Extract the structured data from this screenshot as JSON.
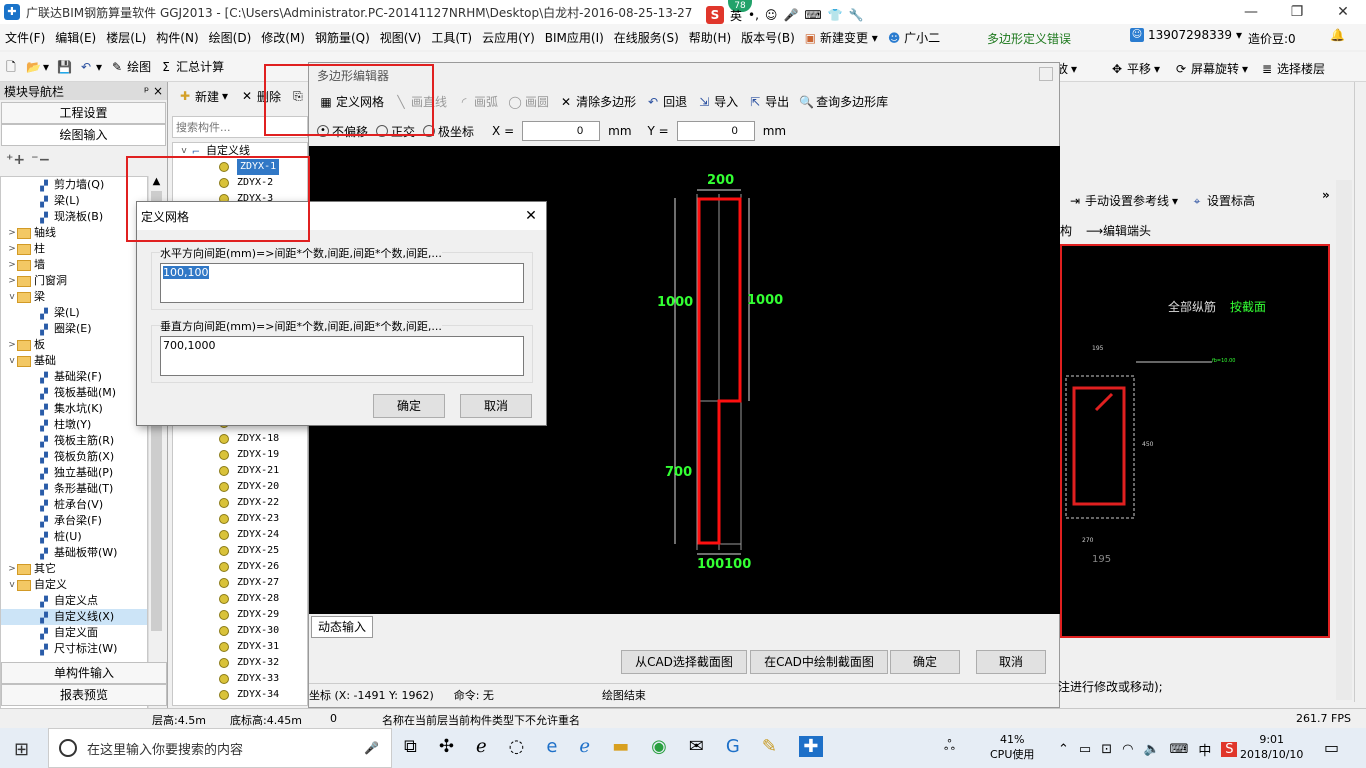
{
  "window": {
    "title": "广联达BIM钢筋算量软件 GGJ2013 - [C:\\Users\\Administrator.PC-20141127NRHM\\Desktop\\白龙村-2016-08-25-13-27",
    "badge": "78",
    "ime_label": "英"
  },
  "menu": {
    "items": [
      "文件(F)",
      "编辑(E)",
      "楼层(L)",
      "构件(N)",
      "绘图(D)",
      "修改(M)",
      "钢筋量(Q)",
      "视图(V)",
      "工具(T)",
      "云应用(Y)",
      "BIM应用(I)",
      "在线服务(S)",
      "帮助(H)",
      "版本号(B)",
      "新建变更",
      "广小二"
    ],
    "error_text": "多边形定义错误",
    "phone": "13907298339",
    "cost_bean": "造价豆:0"
  },
  "toolbar": {
    "draw": "绘图",
    "sum_calc": "汇总计算",
    "zoom": "缩放",
    "pan": "平移",
    "rotate": "屏幕旋转",
    "select_floor": "选择楼层"
  },
  "nav": {
    "title": "模块导航栏",
    "pin": "ᵖ ×",
    "project_settings": "工程设置",
    "drawing_input": "绘图输入",
    "single_input": "单构件输入",
    "report_preview": "报表预览",
    "tree": [
      {
        "label": "剪力墙(Q)",
        "level": 2,
        "kind": "comp"
      },
      {
        "label": "梁(L)",
        "level": 2,
        "kind": "comp"
      },
      {
        "label": "现浇板(B)",
        "level": 2,
        "kind": "comp"
      },
      {
        "label": "轴线",
        "level": 1,
        "kind": "folder",
        "toggle": ">"
      },
      {
        "label": "柱",
        "level": 1,
        "kind": "folder",
        "toggle": ">"
      },
      {
        "label": "墙",
        "level": 1,
        "kind": "folder",
        "toggle": ">"
      },
      {
        "label": "门窗洞",
        "level": 1,
        "kind": "folder",
        "toggle": ">"
      },
      {
        "label": "梁",
        "level": 1,
        "kind": "folder",
        "toggle": "v"
      },
      {
        "label": "梁(L)",
        "level": 2,
        "kind": "comp"
      },
      {
        "label": "圈梁(E)",
        "level": 2,
        "kind": "comp"
      },
      {
        "label": "板",
        "level": 1,
        "kind": "folder",
        "toggle": ">"
      },
      {
        "label": "基础",
        "level": 1,
        "kind": "folder",
        "toggle": "v"
      },
      {
        "label": "基础梁(F)",
        "level": 2,
        "kind": "comp"
      },
      {
        "label": "筏板基础(M)",
        "level": 2,
        "kind": "comp"
      },
      {
        "label": "集水坑(K)",
        "level": 2,
        "kind": "comp"
      },
      {
        "label": "柱墩(Y)",
        "level": 2,
        "kind": "comp"
      },
      {
        "label": "筏板主筋(R)",
        "level": 2,
        "kind": "comp"
      },
      {
        "label": "筏板负筋(X)",
        "level": 2,
        "kind": "comp"
      },
      {
        "label": "独立基础(P)",
        "level": 2,
        "kind": "comp"
      },
      {
        "label": "条形基础(T)",
        "level": 2,
        "kind": "comp"
      },
      {
        "label": "桩承台(V)",
        "level": 2,
        "kind": "comp"
      },
      {
        "label": "承台梁(F)",
        "level": 2,
        "kind": "comp"
      },
      {
        "label": "桩(U)",
        "level": 2,
        "kind": "comp"
      },
      {
        "label": "基础板带(W)",
        "level": 2,
        "kind": "comp"
      },
      {
        "label": "其它",
        "level": 1,
        "kind": "folder",
        "toggle": ">"
      },
      {
        "label": "自定义",
        "level": 1,
        "kind": "folder",
        "toggle": "v"
      },
      {
        "label": "自定义点",
        "level": 2,
        "kind": "comp"
      },
      {
        "label": "自定义线(X)",
        "level": 2,
        "kind": "comp",
        "selected": true
      },
      {
        "label": "自定义面",
        "level": 2,
        "kind": "comp"
      },
      {
        "label": "尺寸标注(W)",
        "level": 2,
        "kind": "comp"
      }
    ]
  },
  "complist": {
    "new": "新建",
    "delete": "删除",
    "search_placeholder": "搜索构件...",
    "root": "自定义线",
    "items": [
      "ZDYX-1",
      "ZDYX-2",
      "ZDYX-3",
      "ZDYX-17",
      "ZDYX-18",
      "ZDYX-19",
      "ZDYX-21",
      "ZDYX-20",
      "ZDYX-22",
      "ZDYX-23",
      "ZDYX-24",
      "ZDYX-25",
      "ZDYX-26",
      "ZDYX-27",
      "ZDYX-28",
      "ZDYX-29",
      "ZDYX-30",
      "ZDYX-31",
      "ZDYX-32",
      "ZDYX-33",
      "ZDYX-34"
    ]
  },
  "poly_editor": {
    "title": "多边形编辑器",
    "define_grid": "定义网格",
    "draw_line": "画直线",
    "draw_arc": "画弧",
    "draw_circle": "画圆",
    "clear_polygon": "清除多边形",
    "undo": "回退",
    "import": "导入",
    "export": "导出",
    "query_lib": "查询多边形库",
    "mode_no_offset": "不偏移",
    "mode_ortho": "正交",
    "mode_polar": "极坐标",
    "x_label": "X =",
    "x_value": "0",
    "y_label": "Y =",
    "y_value": "0",
    "unit": "mm",
    "dims": {
      "top": "200",
      "left": "1000",
      "right": "1000",
      "left2": "700",
      "bottom": "100100"
    },
    "dynamic_input": "动态输入",
    "btn_from_cad": "从CAD选择截面图",
    "btn_draw_in_cad": "在CAD中绘制截面图",
    "btn_ok": "确定",
    "btn_cancel": "取消",
    "coord_text": "坐标 (X: -1491 Y: 1962)",
    "command_text": "命令: 无",
    "draw_end": "绘图结束"
  },
  "right_panel": {
    "set_ref_line": "手动设置参考线",
    "set_elevation": "设置标高",
    "structure": "构",
    "edit_end": "编辑端头",
    "all_long_bars": "全部纵筋",
    "by_section": "按截面",
    "dim_195": "195",
    "dim_450": "450",
    "dim_270": "270",
    "label_fb": "fb=10.00",
    "tail_text": "注进行修改或移动);"
  },
  "grid_dialog": {
    "title": "定义网格",
    "h_label": "水平方向间距(mm)=>间距*个数,间距,间距*个数,间距,...",
    "h_value": "100,100",
    "v_label": "垂直方向间距(mm)=>间距*个数,间距,间距*个数,间距,...",
    "v_value": "700,1000",
    "ok": "确定",
    "cancel": "取消"
  },
  "status": {
    "floor_height": "层高:4.5m",
    "base_elev": "底标高:4.45m",
    "zero": "0",
    "message": "名称在当前层当前构件类型下不允许重名",
    "fps": "261.7 FPS"
  },
  "taskbar": {
    "search_placeholder": "在这里输入你要搜索的内容",
    "cpu_percent": "41%",
    "cpu_label": "CPU使用",
    "lang": "中",
    "time": "9:01",
    "date": "2018/10/10"
  }
}
